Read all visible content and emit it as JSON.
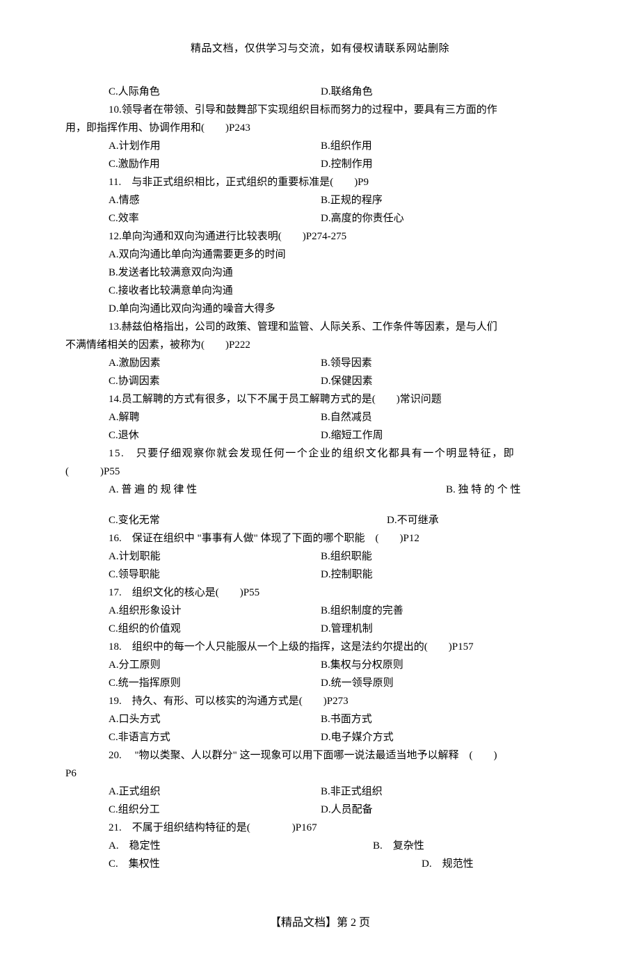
{
  "header": "精品文档，仅供学习与交流，如有侵权请联系网站删除",
  "footer": "【精品文档】第 2 页",
  "q9": {
    "c": "C.人际角色",
    "d": "D.联络角色"
  },
  "q10": {
    "stem1": "10.领导者在带领、引导和鼓舞部下实现组织目标而努力的过程中，要具有三方面的作",
    "stem2": "用，即指挥作用、协调作用和(　　)P243",
    "a": "A.计划作用",
    "b": "B.组织作用",
    "c": "C.激励作用",
    "d": "D.控制作用"
  },
  "q11": {
    "stem": "11.　与非正式组织相比，正式组织的重要标准是(　　)P9",
    "a": "A.情感",
    "b": "B.正规的程序",
    "c": "C.效率",
    "d": "D.高度的你责任心"
  },
  "q12": {
    "stem": "12.单向沟通和双向沟通进行比较表明(　　)P274-275",
    "a": "A.双向沟通比单向沟通需要更多的时间",
    "b": "B.发送者比较满意双向沟通",
    "c": "C.接收者比较满意单向沟通",
    "d": "D.单向沟通比双向沟通的噪音大得多"
  },
  "q13": {
    "stem1": "13.赫兹伯格指出，公司的政策、管理和监管、人际关系、工作条件等因素，是与人们",
    "stem2": "不满情绪相关的因素，被称为(　　)P222",
    "a": "A.激励因素",
    "b": "B.领导因素",
    "c": "C.协调因素",
    "d": "D.保健因素"
  },
  "q14": {
    "stem": "14.员工解聘的方式有很多，以下不属于员工解聘方式的是(　　)常识问题",
    "a": "A.解聘",
    "b": "B.自然减员",
    "c": "C.退休",
    "d": "D.缩短工作周"
  },
  "q15": {
    "stem1": "15.　只要仔细观察你就会发现任何一个企业的组织文化都具有一个明显特征，即",
    "stem2": "(　　　)P55",
    "a": "A. 普 遍 的 规 律 性",
    "b": "B. 独 特 的 个 性",
    "c": "C.变化无常",
    "d": "D.不可继承"
  },
  "q16": {
    "stem": "16.　保证在组织中 \"事事有人做\" 体现了下面的哪个职能　(　　)P12",
    "a": "A.计划职能",
    "b": "B.组织职能",
    "c": "C.领导职能",
    "d": "D.控制职能"
  },
  "q17": {
    "stem": "17.　组织文化的核心是(　　)P55",
    "a": "A.组织形象设计",
    "b": "B.组织制度的完善",
    "c": "C.组织的价值观",
    "d": "D.管理机制"
  },
  "q18": {
    "stem": "18.　组织中的每一个人只能服从一个上级的指挥，这是法约尔提出的(　　)P157",
    "a": "A.分工原则",
    "b": "B.集权与分权原则",
    "c": "C.统一指挥原则",
    "d": "D.统一领导原则"
  },
  "q19": {
    "stem": "19.　持久、有形、可以核实的沟通方式是(　　)P273",
    "a": "A.口头方式",
    "b": "B.书面方式",
    "c": "C.非语言方式",
    "d": "D.电子媒介方式"
  },
  "q20": {
    "stem1": "20.　 \"物以类聚、人以群分\" 这一现象可以用下面哪一说法最适当地予以解释　(　　)",
    "stem2": "P6",
    "a": "A.正式组织",
    "b": "B.非正式组织",
    "c": "C.组织分工",
    "d": "D.人员配备"
  },
  "q21": {
    "stem": "21.　不属于组织结构特征的是(　　　　)P167",
    "a": "A.　稳定性",
    "b": "B.　复杂性",
    "c": "C.　集权性",
    "d": "D.　规范性"
  }
}
